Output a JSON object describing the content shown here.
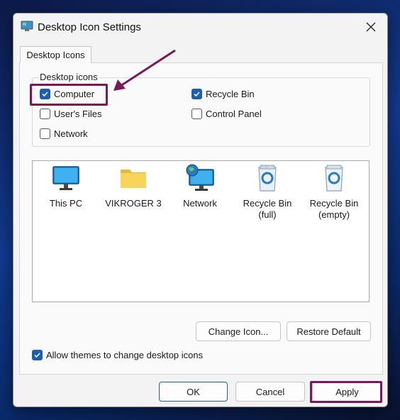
{
  "dialog": {
    "title": "Desktop Icon Settings",
    "close_label": "✕"
  },
  "tabs": [
    {
      "label": "Desktop Icons",
      "active": true
    }
  ],
  "desktop_icons_group": {
    "title": "Desktop icons",
    "options": [
      {
        "label": "Computer",
        "checked": true
      },
      {
        "label": "Recycle Bin",
        "checked": true
      },
      {
        "label": "User's Files",
        "checked": false
      },
      {
        "label": "Control Panel",
        "checked": false
      },
      {
        "label": "Network",
        "checked": false
      }
    ]
  },
  "icon_list": [
    {
      "line1": "This PC",
      "line2": "",
      "icon": "monitor-icon"
    },
    {
      "line1": "VIKROGER 3",
      "line2": "",
      "icon": "folder-icon"
    },
    {
      "line1": "Network",
      "line2": "",
      "icon": "network-icon"
    },
    {
      "line1": "Recycle Bin",
      "line2": "(full)",
      "icon": "recycle-bin-full-icon"
    },
    {
      "line1": "Recycle Bin",
      "line2": "(empty)",
      "icon": "recycle-bin-empty-icon"
    }
  ],
  "buttons": {
    "change_icon": "Change Icon...",
    "restore_default": "Restore Default",
    "ok": "OK",
    "cancel": "Cancel",
    "apply": "Apply"
  },
  "allow_themes": {
    "label": "Allow themes to change desktop icons",
    "checked": true
  },
  "colors": {
    "accent": "#1a5fb4",
    "annotation": "#7a1a55"
  }
}
